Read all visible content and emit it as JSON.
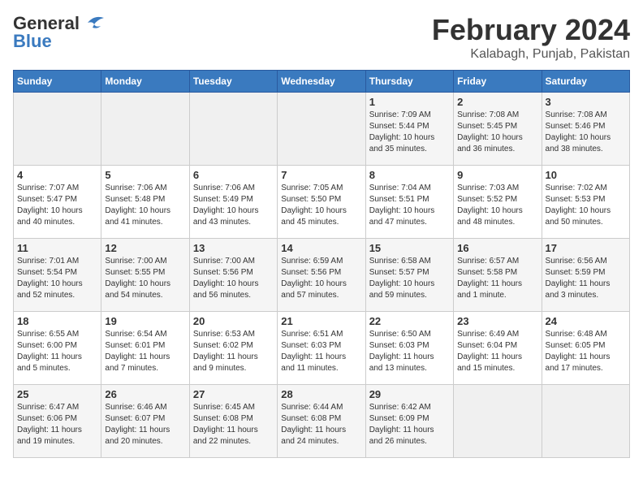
{
  "header": {
    "logo_general": "General",
    "logo_blue": "Blue",
    "title": "February 2024",
    "subtitle": "Kalabagh, Punjab, Pakistan"
  },
  "columns": [
    "Sunday",
    "Monday",
    "Tuesday",
    "Wednesday",
    "Thursday",
    "Friday",
    "Saturday"
  ],
  "weeks": [
    [
      {
        "day": "",
        "info": ""
      },
      {
        "day": "",
        "info": ""
      },
      {
        "day": "",
        "info": ""
      },
      {
        "day": "",
        "info": ""
      },
      {
        "day": "1",
        "info": "Sunrise: 7:09 AM\nSunset: 5:44 PM\nDaylight: 10 hours\nand 35 minutes."
      },
      {
        "day": "2",
        "info": "Sunrise: 7:08 AM\nSunset: 5:45 PM\nDaylight: 10 hours\nand 36 minutes."
      },
      {
        "day": "3",
        "info": "Sunrise: 7:08 AM\nSunset: 5:46 PM\nDaylight: 10 hours\nand 38 minutes."
      }
    ],
    [
      {
        "day": "4",
        "info": "Sunrise: 7:07 AM\nSunset: 5:47 PM\nDaylight: 10 hours\nand 40 minutes."
      },
      {
        "day": "5",
        "info": "Sunrise: 7:06 AM\nSunset: 5:48 PM\nDaylight: 10 hours\nand 41 minutes."
      },
      {
        "day": "6",
        "info": "Sunrise: 7:06 AM\nSunset: 5:49 PM\nDaylight: 10 hours\nand 43 minutes."
      },
      {
        "day": "7",
        "info": "Sunrise: 7:05 AM\nSunset: 5:50 PM\nDaylight: 10 hours\nand 45 minutes."
      },
      {
        "day": "8",
        "info": "Sunrise: 7:04 AM\nSunset: 5:51 PM\nDaylight: 10 hours\nand 47 minutes."
      },
      {
        "day": "9",
        "info": "Sunrise: 7:03 AM\nSunset: 5:52 PM\nDaylight: 10 hours\nand 48 minutes."
      },
      {
        "day": "10",
        "info": "Sunrise: 7:02 AM\nSunset: 5:53 PM\nDaylight: 10 hours\nand 50 minutes."
      }
    ],
    [
      {
        "day": "11",
        "info": "Sunrise: 7:01 AM\nSunset: 5:54 PM\nDaylight: 10 hours\nand 52 minutes."
      },
      {
        "day": "12",
        "info": "Sunrise: 7:00 AM\nSunset: 5:55 PM\nDaylight: 10 hours\nand 54 minutes."
      },
      {
        "day": "13",
        "info": "Sunrise: 7:00 AM\nSunset: 5:56 PM\nDaylight: 10 hours\nand 56 minutes."
      },
      {
        "day": "14",
        "info": "Sunrise: 6:59 AM\nSunset: 5:56 PM\nDaylight: 10 hours\nand 57 minutes."
      },
      {
        "day": "15",
        "info": "Sunrise: 6:58 AM\nSunset: 5:57 PM\nDaylight: 10 hours\nand 59 minutes."
      },
      {
        "day": "16",
        "info": "Sunrise: 6:57 AM\nSunset: 5:58 PM\nDaylight: 11 hours\nand 1 minute."
      },
      {
        "day": "17",
        "info": "Sunrise: 6:56 AM\nSunset: 5:59 PM\nDaylight: 11 hours\nand 3 minutes."
      }
    ],
    [
      {
        "day": "18",
        "info": "Sunrise: 6:55 AM\nSunset: 6:00 PM\nDaylight: 11 hours\nand 5 minutes."
      },
      {
        "day": "19",
        "info": "Sunrise: 6:54 AM\nSunset: 6:01 PM\nDaylight: 11 hours\nand 7 minutes."
      },
      {
        "day": "20",
        "info": "Sunrise: 6:53 AM\nSunset: 6:02 PM\nDaylight: 11 hours\nand 9 minutes."
      },
      {
        "day": "21",
        "info": "Sunrise: 6:51 AM\nSunset: 6:03 PM\nDaylight: 11 hours\nand 11 minutes."
      },
      {
        "day": "22",
        "info": "Sunrise: 6:50 AM\nSunset: 6:03 PM\nDaylight: 11 hours\nand 13 minutes."
      },
      {
        "day": "23",
        "info": "Sunrise: 6:49 AM\nSunset: 6:04 PM\nDaylight: 11 hours\nand 15 minutes."
      },
      {
        "day": "24",
        "info": "Sunrise: 6:48 AM\nSunset: 6:05 PM\nDaylight: 11 hours\nand 17 minutes."
      }
    ],
    [
      {
        "day": "25",
        "info": "Sunrise: 6:47 AM\nSunset: 6:06 PM\nDaylight: 11 hours\nand 19 minutes."
      },
      {
        "day": "26",
        "info": "Sunrise: 6:46 AM\nSunset: 6:07 PM\nDaylight: 11 hours\nand 20 minutes."
      },
      {
        "day": "27",
        "info": "Sunrise: 6:45 AM\nSunset: 6:08 PM\nDaylight: 11 hours\nand 22 minutes."
      },
      {
        "day": "28",
        "info": "Sunrise: 6:44 AM\nSunset: 6:08 PM\nDaylight: 11 hours\nand 24 minutes."
      },
      {
        "day": "29",
        "info": "Sunrise: 6:42 AM\nSunset: 6:09 PM\nDaylight: 11 hours\nand 26 minutes."
      },
      {
        "day": "",
        "info": ""
      },
      {
        "day": "",
        "info": ""
      }
    ]
  ]
}
